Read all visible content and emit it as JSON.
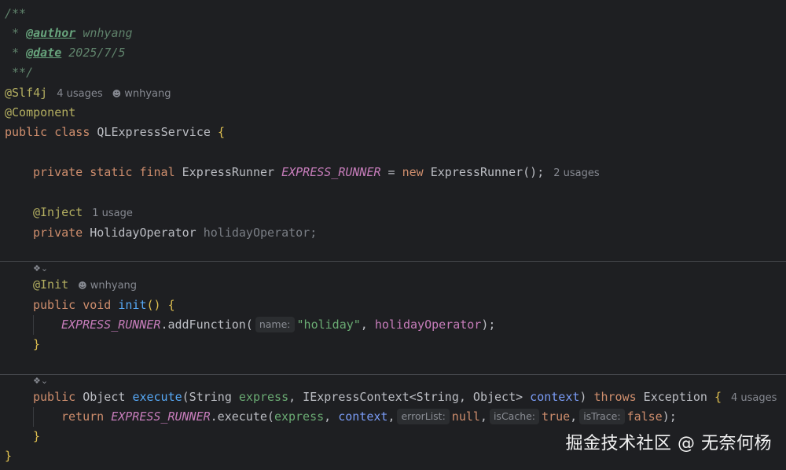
{
  "doc": {
    "open": "/**",
    "author_tag": "@author",
    "author": " wnhyang",
    "date_tag": "@date",
    "date": " 2025/7/5",
    "close": " **/"
  },
  "class_decl": {
    "slf4j": "@Slf4j",
    "slf4j_usages": "4 usages",
    "slf4j_author": "wnhyang",
    "component": "@Component",
    "kw_public": "public",
    "kw_class": "class",
    "name": "QLExpressService",
    "open_brace": "{"
  },
  "runner_field": {
    "mods": "private static final",
    "type": "ExpressRunner",
    "name": "EXPRESS_RUNNER",
    "eq": " = ",
    "kw_new": "new",
    "ctor": " ExpressRunner();",
    "usages": "2 usages"
  },
  "inject_field": {
    "anno": "@Inject",
    "usages": "1 usage",
    "mods": "private",
    "type": "HolidayOperator",
    "name": "holidayOperator",
    "semi": ";"
  },
  "init_method": {
    "anno": "@Init",
    "author": "wnhyang",
    "kw": "public void",
    "name": "init",
    "sig_rest": "() {",
    "call_obj": "EXPRESS_RUNNER",
    "call_fn": ".addFunction(",
    "hint_name": "name:",
    "arg1": "\"holiday\"",
    "comma": ", ",
    "arg2": "holidayOperator",
    "close": ");",
    "end": "}"
  },
  "execute_method": {
    "kw_public": "public",
    "ret_type": " Object ",
    "name": "execute",
    "p1_type": "(String ",
    "p1_name": "express",
    "p2_type": ", IExpressContext<String, Object> ",
    "p2_name": "context",
    "close_paren": ")",
    "kw_throws": "throws",
    "exc": " Exception ",
    "brace": "{",
    "usages": "4 usages",
    "kw_return": "return",
    "call_obj": "EXPRESS_RUNNER",
    "call_fn": ".execute(",
    "a1": "express",
    "a2": "context",
    "hint_errorList": "errorList:",
    "v_null": "null",
    "hint_isCache": "isCache:",
    "v_true": "true",
    "hint_isTrace": "isTrace:",
    "v_false": "false",
    "close": ");",
    "end": "}"
  },
  "class_end": "}",
  "gutter_icon": "method-marker-icon",
  "watermark": "掘金技术社区 @ 无奈何杨"
}
